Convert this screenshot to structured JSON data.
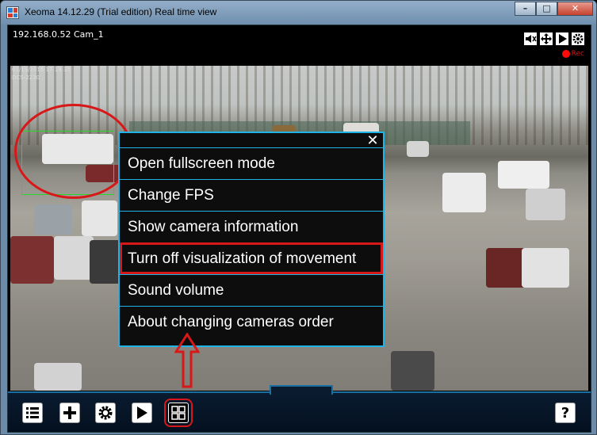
{
  "window": {
    "title": "Xeoma 14.12.29 (Trial edition) Real time view",
    "minimize": "–",
    "maximize": "□",
    "close": "✕"
  },
  "camera": {
    "name": "192.168.0.52 Cam_1",
    "rec_label": "Rec",
    "timestamp_line1": "01/19/2015 17:19:35",
    "timestamp_line2": "DCS-2230",
    "controls": [
      "mute-icon",
      "fullscreen-icon",
      "play-icon",
      "settings-icon"
    ]
  },
  "menu": {
    "close_label": "✕",
    "items": [
      "Open fullscreen mode",
      "Change FPS",
      "Show camera information",
      "Turn off visualization of movement",
      "Sound volume",
      "About changing cameras order"
    ],
    "highlighted_index": 3
  },
  "toolbar": {
    "items": [
      "list-icon",
      "add-icon",
      "gear-icon",
      "play-icon",
      "layout-grid-icon"
    ],
    "help_label": "?"
  },
  "colors": {
    "accent": "#1fb3e6",
    "highlight": "#d81818",
    "rec": "#ff0a0a"
  }
}
